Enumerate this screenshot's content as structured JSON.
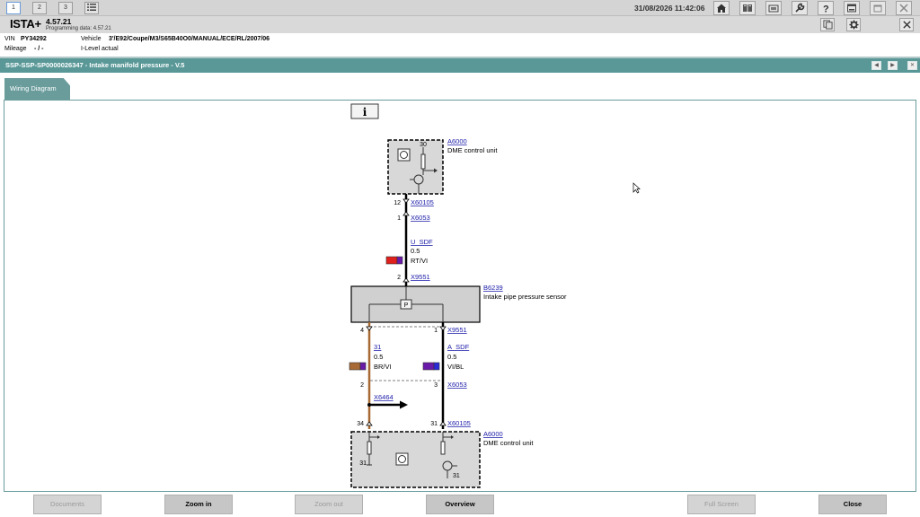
{
  "topbar": {
    "tabs": [
      "1",
      "2",
      "3"
    ],
    "datetime": "31/08/2026 11:42:06"
  },
  "header": {
    "app_name": "ISTA+",
    "version": "4.57.21",
    "programming_data": "Programming data:  4.57.21"
  },
  "vehicle": {
    "vin_label": "VIN",
    "vin": "PY34292",
    "vehicle_label": "Vehicle",
    "vehicle": "3'/E92/Coupe/M3/S65B40O0/MANUAL/ECE/RL/2007/06",
    "mileage_label": "Mileage",
    "mileage": "- / -",
    "ilevel": "I-Level actual"
  },
  "title": "SSP-SSP-SP0000026347 - Intake manifold pressure - V.5",
  "tab_label": "Wiring Diagram",
  "diagram": {
    "info_icon": "i",
    "dme_top": {
      "id": "A6000",
      "name": "DME control unit",
      "pin_30": "30"
    },
    "conn_x60105_top": {
      "id": "X60105",
      "pin": "12"
    },
    "conn_x6053_top": {
      "id": "X6053",
      "pin": "1"
    },
    "wire_u_sdf": {
      "signal": "U_SDF",
      "size": "0.5",
      "color": "RT/VI"
    },
    "conn_x9551_top": {
      "id": "X9551",
      "pin": "2"
    },
    "sensor": {
      "id": "B6239",
      "name": "Intake pipe pressure sensor",
      "symbol": "P"
    },
    "conn_x9551_bottom": {
      "id": "X9551",
      "pin_left": "4",
      "pin_right": "1"
    },
    "wire_31": {
      "signal": "31",
      "size": "0.5",
      "color": "BR/VI"
    },
    "wire_a_sdf": {
      "signal": "A_SDF",
      "size": "0.5",
      "color": "VI/BL"
    },
    "conn_left": {
      "pin": "2"
    },
    "conn_x6053_bottom": {
      "id": "X6053",
      "pin": "3"
    },
    "conn_x6464": {
      "id": "X6464"
    },
    "conn_x60105_bottom": {
      "id": "X60105",
      "pin_left": "34",
      "pin_right": "31"
    },
    "dme_bottom": {
      "id": "A6000",
      "name": "DME control unit",
      "pin_31a": "31",
      "pin_31b": "31"
    }
  },
  "buttons": {
    "documents": "Documents",
    "zoom_in": "Zoom in",
    "zoom_out": "Zoom out",
    "overview": "Overview",
    "full_screen": "Full Screen",
    "close": "Close"
  },
  "colors": {
    "accent": "#5a9898",
    "wire_red": "#e0201c",
    "wire_violet": "#6a1aa8",
    "wire_brown": "#a86a34",
    "wire_blue": "#2a2ad8"
  }
}
